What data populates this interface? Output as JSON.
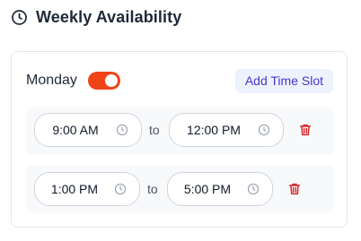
{
  "header": {
    "title": "Weekly Availability",
    "icon": "clock-icon"
  },
  "day": {
    "label": "Monday",
    "enabled": true,
    "add_slot_label": "Add Time Slot"
  },
  "slots": [
    {
      "start": "9:00 AM",
      "separator": "to",
      "end": "12:00 PM"
    },
    {
      "start": "1:00 PM",
      "separator": "to",
      "end": "5:00 PM"
    }
  ],
  "colors": {
    "toggle_on": "#f04418",
    "accent": "#4338ca",
    "accent_bg": "#eef2ff",
    "delete": "#dc2626"
  }
}
